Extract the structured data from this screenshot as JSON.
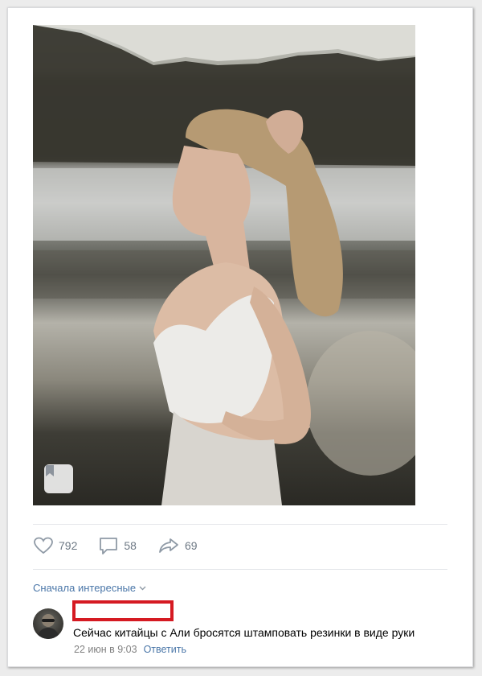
{
  "post": {
    "photo_alt": "Photo: woman with ponytail by the water",
    "likes": "792",
    "comments": "58",
    "shares": "69"
  },
  "comments_section": {
    "sort_label": "Сначала интересные",
    "comment": {
      "author": "",
      "text": "Сейчас китайцы с Али бросятся штамповать резинки в виде руки",
      "date": "22 июн в 9:03",
      "reply_label": "Ответить"
    }
  },
  "colors": {
    "link": "#4a76a8",
    "muted": "#6d7884",
    "redaction": "#d51a22"
  },
  "icons": [
    "bookmark-icon",
    "heart-icon",
    "comment-icon",
    "share-icon",
    "chevron-down-icon"
  ]
}
